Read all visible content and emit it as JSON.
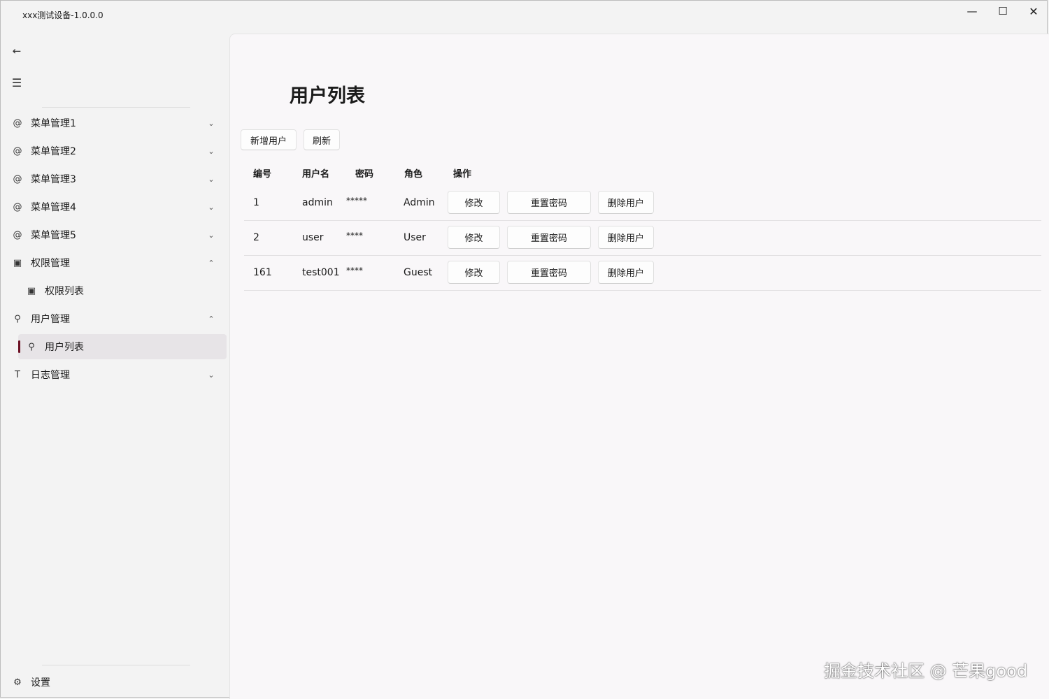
{
  "window": {
    "title": "xxx测试设备-1.0.0.0",
    "minimize_icon": "—",
    "maximize_icon": "☐",
    "close_icon": "✕"
  },
  "sidebar": {
    "back_icon": "←",
    "menu_icon": "☰",
    "items": [
      {
        "label": "菜单管理1",
        "icon": "@",
        "chevron": "⌄"
      },
      {
        "label": "菜单管理2",
        "icon": "@",
        "chevron": "⌄"
      },
      {
        "label": "菜单管理3",
        "icon": "@",
        "chevron": "⌄"
      },
      {
        "label": "菜单管理4",
        "icon": "@",
        "chevron": "⌄"
      },
      {
        "label": "菜单管理5",
        "icon": "@",
        "chevron": "⌄"
      },
      {
        "label": "权限管理",
        "icon": "▣",
        "chevron": "⌃",
        "children": [
          {
            "label": "权限列表",
            "icon": "▣"
          }
        ]
      },
      {
        "label": "用户管理",
        "icon": "⚲",
        "chevron": "⌃",
        "children": [
          {
            "label": "用户列表",
            "icon": "⚲",
            "selected": true
          }
        ]
      },
      {
        "label": "日志管理",
        "icon": "T",
        "chevron": "⌄"
      }
    ],
    "settings": {
      "label": "设置",
      "icon": "⚙"
    },
    "accent_color": "#6b0f22"
  },
  "main": {
    "title": "用户列表",
    "toolbar": {
      "add_label": "新增用户",
      "refresh_label": "刷新"
    },
    "table": {
      "headers": [
        "编号",
        "用户名",
        "密码",
        "角色",
        "操作"
      ],
      "rows": [
        {
          "id": "1",
          "username": "admin",
          "password": "*****",
          "role": "Admin"
        },
        {
          "id": "2",
          "username": "user",
          "password": "****",
          "role": "User"
        },
        {
          "id": "161",
          "username": "test001",
          "password": "****",
          "role": "Guest"
        }
      ],
      "actions": {
        "edit": "修改",
        "reset": "重置密码",
        "delete": "删除用户"
      }
    }
  },
  "watermark": "掘金技术社区 @ 芒果good"
}
